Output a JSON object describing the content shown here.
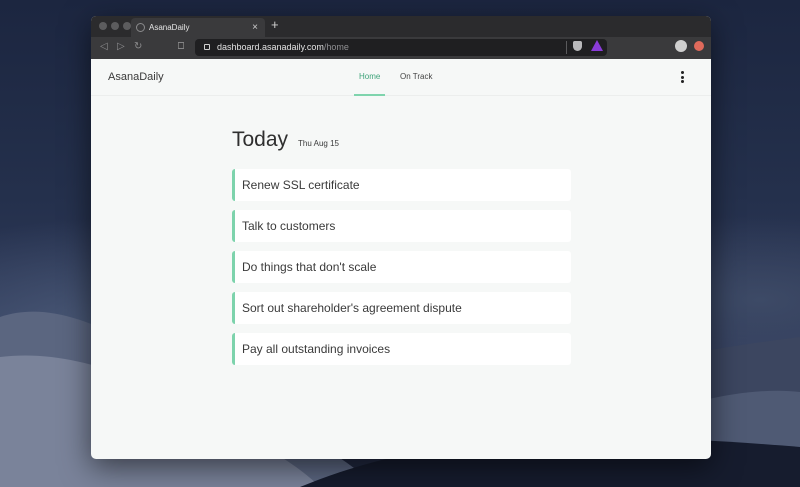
{
  "browser": {
    "tab_title": "AsanaDaily",
    "new_tab_symbol": "+",
    "close_symbol": "×",
    "url_host": "dashboard.asanadaily.com",
    "url_path": "/home"
  },
  "app": {
    "brand": "AsanaDaily",
    "nav": {
      "home": "Home",
      "on_track": "On Track"
    },
    "active_nav": "Home",
    "accent_color": "#7dd3ac"
  },
  "today": {
    "heading": "Today",
    "date": "Thu Aug 15",
    "tasks": [
      "Renew SSL certificate",
      "Talk to customers",
      "Do things that don't scale",
      "Sort out shareholder's agreement dispute",
      "Pay all outstanding invoices"
    ]
  },
  "icons": [
    "back-icon",
    "forward-icon",
    "reload-icon",
    "bookmark-icon",
    "lock-icon",
    "brave-shield-icon",
    "brave-rewards-icon",
    "profile-avatar-icon",
    "extension-icon",
    "kebab-menu-icon"
  ]
}
